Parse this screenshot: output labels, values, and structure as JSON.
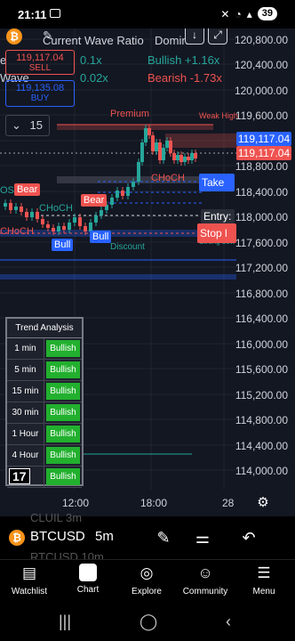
{
  "status_bar": {
    "time": "21:11",
    "battery": "39"
  },
  "chart_header": {
    "wave_ratio_label": "Current Wave Ratio",
    "dominant_label": "Domin",
    "ratio_1": "0.1x",
    "ratio_2": "0.02x",
    "bullish": "Bullish +1.16x",
    "bearish": "Bearish -1.73x",
    "cut_label_e": "e",
    "cut_label_wave": "Wave"
  },
  "order_panel": {
    "sell_price": "119,117.04",
    "sell_label": "SELL",
    "buy_price": "119,135.08",
    "buy_label": "BUY",
    "quantity": "15"
  },
  "price_axis": {
    "labels": [
      "120,800.00",
      "120,400.00",
      "120,000.00",
      "119,600.00",
      "118,800.00",
      "118,400.00",
      "118,000.00",
      "117,600.00",
      "117,200.00",
      "116,800.00",
      "116,400.00",
      "116,000.00",
      "115,600.00",
      "115,200.00",
      "114,800.00",
      "114,400.00",
      "114,000.00"
    ],
    "ask_tag": "119,117.04",
    "bid_tag": "119,117.04"
  },
  "smc_labels": {
    "premium": "Premium",
    "weak_high": "Weak High",
    "choch_1": "CHoCH",
    "choch_2": "CHoCH",
    "choch_3": "CHoCH",
    "bos_fragment": "OS",
    "discount": "Discount",
    "strong_low": "Strong Low",
    "bear_1": "Bear",
    "bear_2": "Bear",
    "bull_1": "Bull",
    "bull_2": "Bull",
    "take": "Take",
    "entry": "Entry:",
    "stop": "Stop l"
  },
  "trend_table": {
    "title": "Trend Analysis",
    "rows": [
      {
        "tf": "1 min",
        "value": "Bullish"
      },
      {
        "tf": "5 min",
        "value": "Bullish"
      },
      {
        "tf": "15 min",
        "value": "Bullish"
      },
      {
        "tf": "30 min",
        "value": "Bullish"
      },
      {
        "tf": "1 Hour",
        "value": "Bullish"
      },
      {
        "tf": "4 Hour",
        "value": "Bullish"
      },
      {
        "tf": "",
        "value": "Bullish"
      }
    ],
    "logo": "17"
  },
  "time_axis": {
    "t1": "12:00",
    "t2": "18:00",
    "t3": "28"
  },
  "symbol_bar": {
    "symbol": "BTCUSD",
    "interval": "5m",
    "ghost_above": "CLUIL      3m",
    "ghost_below": "RTCUSD    10m"
  },
  "bottom_nav": [
    {
      "label": "Watchlist"
    },
    {
      "label": "Chart"
    },
    {
      "label": "Explore"
    },
    {
      "label": "Community"
    },
    {
      "label": "Menu"
    }
  ],
  "colors": {
    "bg": "#131722",
    "bull": "#26a69a",
    "bear": "#ef5350",
    "blue": "#2962ff",
    "trend_green": "#22b02e"
  }
}
